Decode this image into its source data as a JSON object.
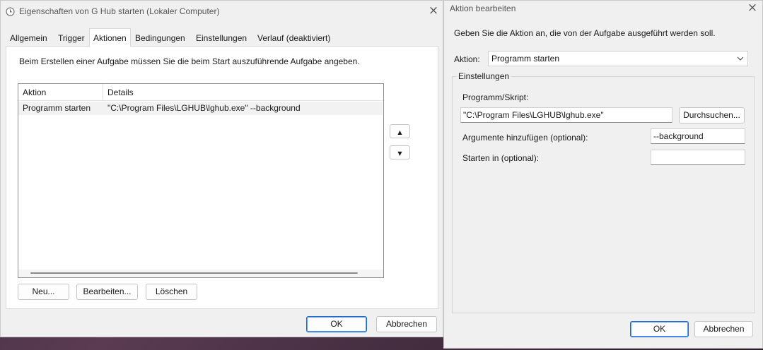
{
  "left_window": {
    "title": "Eigenschaften von G Hub starten (Lokaler Computer)",
    "tabs": [
      {
        "label": "Allgemein"
      },
      {
        "label": "Trigger"
      },
      {
        "label": "Aktionen"
      },
      {
        "label": "Bedingungen"
      },
      {
        "label": "Einstellungen"
      },
      {
        "label": "Verlauf (deaktiviert)"
      }
    ],
    "active_tab": "Aktionen",
    "description": "Beim Erstellen einer Aufgabe müssen Sie die beim Start auszuführende Aufgabe angeben.",
    "table": {
      "columns": [
        "Aktion",
        "Details"
      ],
      "rows": [
        {
          "action": "Programm starten",
          "details": "\"C:\\Program Files\\LGHUB\\lghub.exe\" --background"
        }
      ]
    },
    "buttons": {
      "new": "Neu...",
      "edit": "Bearbeiten...",
      "delete": "Löschen",
      "ok": "OK",
      "cancel": "Abbrechen"
    }
  },
  "right_window": {
    "title": "Aktion bearbeiten",
    "instruction": "Geben Sie die Aktion an, die von der Aufgabe ausgeführt werden soll.",
    "action_label": "Aktion:",
    "action_value": "Programm starten",
    "group_title": "Einstellungen",
    "program_label": "Programm/Skript:",
    "program_value": "\"C:\\Program Files\\LGHUB\\lghub.exe\"",
    "browse_button": "Durchsuchen...",
    "arguments_label": "Argumente hinzufügen (optional):",
    "arguments_value": "--background",
    "start_in_label": "Starten in (optional):",
    "start_in_value": "",
    "buttons": {
      "ok": "OK",
      "cancel": "Abbrechen"
    }
  }
}
